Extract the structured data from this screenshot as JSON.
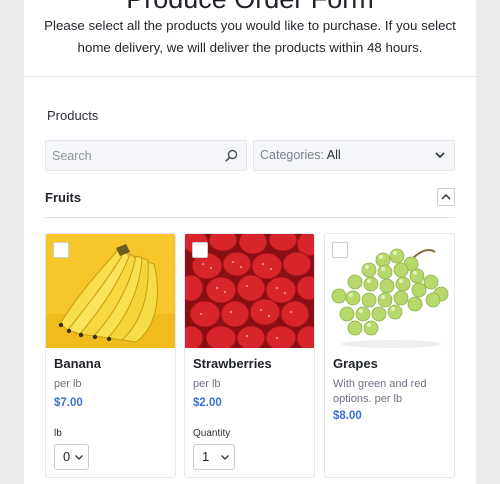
{
  "form": {
    "title": "Produce Order Form",
    "description": "Please select all the products you would like to purchase. If you select home delivery, we will deliver the products within 48 hours."
  },
  "products_section": {
    "label": "Products",
    "search": {
      "placeholder": "Search",
      "value": "",
      "icon": "search-icon"
    },
    "category_filter": {
      "label": "Categories:",
      "value": "All",
      "icon": "chevron-down-icon"
    }
  },
  "group": {
    "title": "Fruits",
    "collapse_icon": "chevron-up-icon",
    "items": [
      {
        "name": "Banana",
        "subtitle": "per lb",
        "price": "$7.00",
        "qty_label": "lb",
        "qty_value": "0",
        "checked": false
      },
      {
        "name": "Strawberries",
        "subtitle": "per lb",
        "price": "$2.00",
        "qty_label": "Quantity",
        "qty_value": "1",
        "checked": false
      },
      {
        "name": "Grapes",
        "subtitle": "With green and red options. per lb",
        "price": "$8.00",
        "checked": false
      }
    ]
  },
  "colors": {
    "accent": "#3b6fd4",
    "background": "#ebebeb",
    "card": "#ffffff"
  }
}
